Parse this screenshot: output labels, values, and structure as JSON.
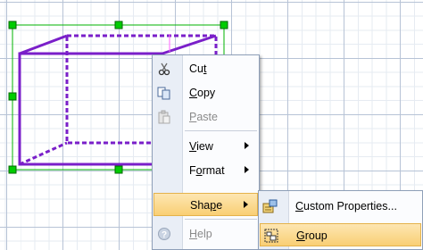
{
  "canvas": {
    "grid_color": "#b7c3d6",
    "shape_color": "#7a1fc9",
    "selection_color": "#00b300"
  },
  "context_menu": {
    "items": [
      {
        "pre": "Cu",
        "ul": "t",
        "post": "",
        "icon": "scissors-icon",
        "enabled": true
      },
      {
        "pre": "",
        "ul": "C",
        "post": "opy",
        "icon": "copy-icon",
        "enabled": true
      },
      {
        "pre": "",
        "ul": "P",
        "post": "aste",
        "icon": "paste-icon",
        "enabled": false
      },
      {
        "pre": "",
        "ul": "V",
        "post": "iew",
        "submenu": true,
        "enabled": true
      },
      {
        "pre": "F",
        "ul": "o",
        "post": "rmat",
        "submenu": true,
        "enabled": true
      },
      {
        "pre": "Sha",
        "ul": "p",
        "post": "e",
        "submenu": true,
        "enabled": true,
        "highlighted": true
      },
      {
        "pre": "",
        "ul": "H",
        "post": "elp",
        "icon": "help-icon",
        "enabled": false
      }
    ]
  },
  "shape_submenu": {
    "items": [
      {
        "pre": "",
        "ul": "C",
        "post": "ustom Properties...",
        "icon": "custom-properties-icon"
      },
      {
        "pre": "",
        "ul": "G",
        "post": "roup",
        "icon": "group-icon",
        "highlighted": true
      }
    ]
  }
}
